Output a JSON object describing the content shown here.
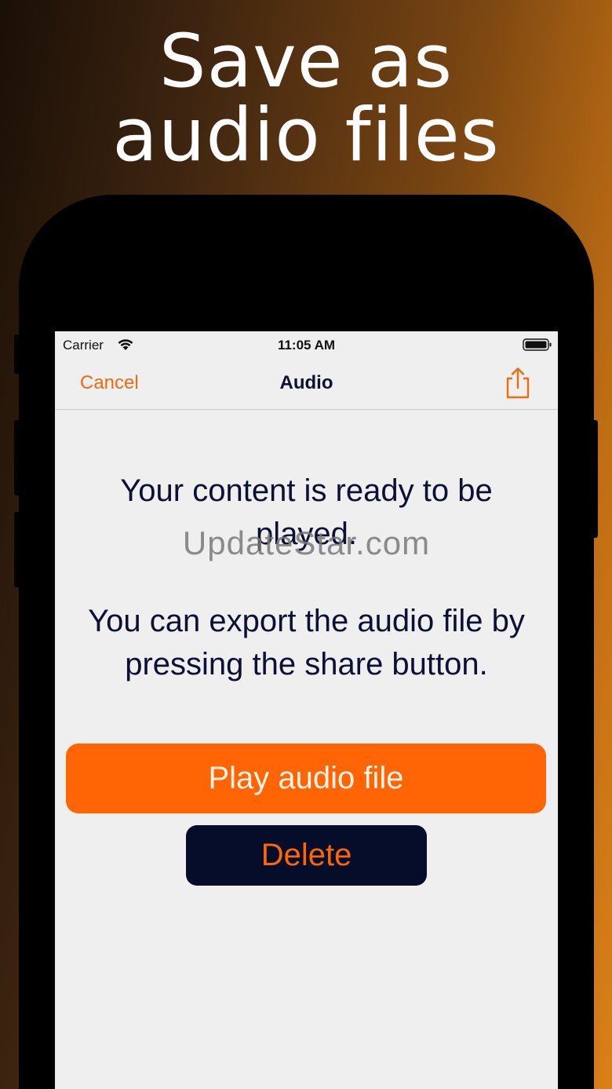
{
  "headline": {
    "line1": "Save as",
    "line2": "audio files"
  },
  "status_bar": {
    "carrier": "Carrier",
    "time": "11:05 AM",
    "wifi_icon": "wifi-icon",
    "battery_icon": "battery-icon"
  },
  "nav": {
    "cancel_label": "Cancel",
    "title": "Audio",
    "share_icon": "share-icon"
  },
  "content": {
    "ready_message": "Your content is ready to be played.",
    "export_message": "You can export the audio file by pressing the share button.",
    "watermark": "UpdateStar.com"
  },
  "buttons": {
    "play_label": "Play audio file",
    "delete_label": "Delete"
  },
  "colors": {
    "accent": "#ff6505",
    "dark_navy": "#060d2a",
    "screen_background": "#efefef"
  }
}
